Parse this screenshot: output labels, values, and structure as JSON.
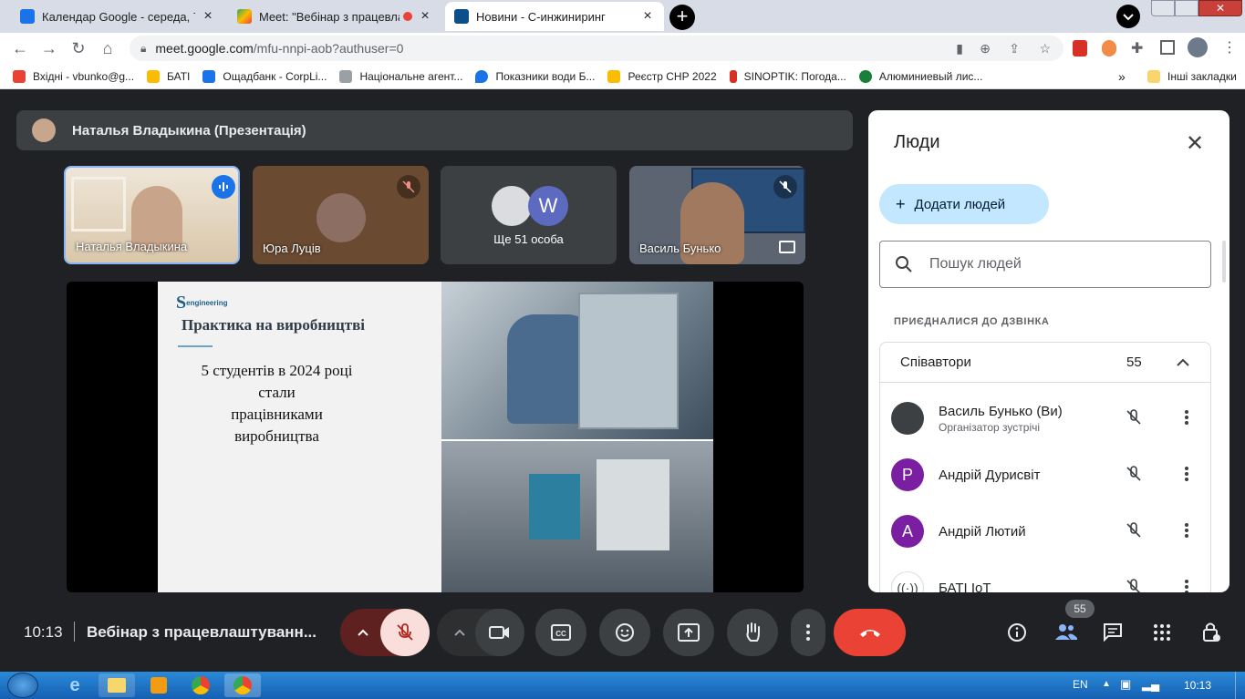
{
  "browser": {
    "tabs": [
      {
        "title": "Календар Google - середа, 7 тр",
        "close": "×"
      },
      {
        "title": "Meet: \"Вебінар з працевлаш",
        "close": "×"
      },
      {
        "title": "Новини - С-инжиниринг",
        "close": "×"
      }
    ],
    "new_tab": "+",
    "url_host": "meet.google.com",
    "url_path": "/mfu-nnpi-aob?authuser=0",
    "bookmarks": [
      {
        "label": "Вхідні - vbunko@g...",
        "color": "#ea4335"
      },
      {
        "label": "БАТІ",
        "color": "#fbbc04"
      },
      {
        "label": "Ощадбанк - CorpLi...",
        "color": "#1a73e8"
      },
      {
        "label": "Національне агент...",
        "color": "#9aa0a6"
      },
      {
        "label": "Показники води Б...",
        "color": "#1a73e8"
      },
      {
        "label": "Реєстр СНР 2022",
        "color": "#fbbc04"
      },
      {
        "label": "SINOPTIK: Погода...",
        "color": "#d93025"
      },
      {
        "label": "Алюминиевый лис...",
        "color": "#188038"
      }
    ],
    "more_bookmarks": "»",
    "other_bookmarks": "Інші закладки"
  },
  "meet": {
    "presenter": "Наталья Владыкина (Презентація)",
    "tiles": [
      {
        "name": "Наталья Владыкина"
      },
      {
        "name": "Юра Луців"
      },
      {
        "name": "Ще 51 особа",
        "avatar_letter": "W"
      },
      {
        "name": "Василь Бунько"
      }
    ],
    "slide": {
      "logo": "engineering",
      "title": "Практика на виробництві",
      "lines": [
        "5 студентів в 2024 році",
        "стали",
        "працівниками",
        "виробництва"
      ]
    },
    "people_panel": {
      "title": "Люди",
      "add_label": "Додати людей",
      "search_placeholder": "Пошук людей",
      "section_label": "ПРИЄДНАЛИСЯ ДО ДЗВІНКА",
      "group_label": "Співавтори",
      "group_count": "55",
      "participants": [
        {
          "name": "Василь Бунько (Ви)",
          "role": "Організатор зустрічі",
          "letter": "",
          "color": "#3c4043"
        },
        {
          "name": "Андрій Дурисвіт",
          "role": "",
          "letter": "Р",
          "color": "#7b1fa2"
        },
        {
          "name": "Андрій Лютий",
          "role": "",
          "letter": "А",
          "color": "#7b1fa2"
        },
        {
          "name": "БАТІ IoT",
          "role": "",
          "letter": "",
          "color": "#ffffff"
        }
      ]
    },
    "controls": {
      "time": "10:13",
      "meeting_title": "Вебінар з працевлаштуванн...",
      "people_badge": "55"
    }
  },
  "taskbar": {
    "lang": "EN",
    "clock": "10:13"
  }
}
